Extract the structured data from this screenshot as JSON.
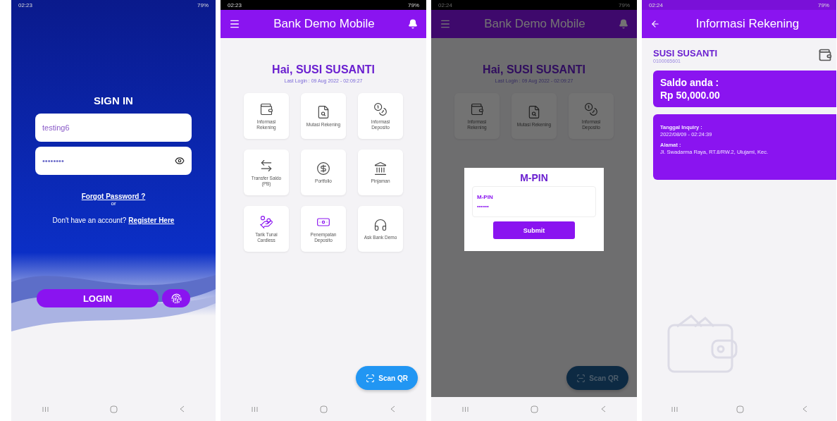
{
  "screens": [
    {
      "kind": "login",
      "status_time": "02:23",
      "battery": "79%",
      "title": "SIGN IN",
      "username": "testing6",
      "password": "••••••••",
      "forgot": "Forgot Password ?",
      "or": "or",
      "register_prompt": "Don't have an account?",
      "register_link": "Register Here",
      "login_button": "LOGIN"
    },
    {
      "kind": "dashboard",
      "status_time": "02:23",
      "battery": "79%",
      "app_title": "Bank Demo Mobile",
      "greeting": "Hai, SUSI SUSANTI",
      "last_login": "Last Login : 09 Aug 2022 - 02:09:27",
      "menu": [
        {
          "label": "Informasi Rekening"
        },
        {
          "label": "Mutasi Rekening"
        },
        {
          "label": "Informasi Deposito"
        },
        {
          "label": "Transfer Saldo (PB)"
        },
        {
          "label": "Portfolio"
        },
        {
          "label": "Pinjaman"
        },
        {
          "label": "Tarik Tunai Cardless"
        },
        {
          "label": "Penempatan Deposito"
        },
        {
          "label": "Ask Bank Demo"
        }
      ],
      "scan_button": "Scan QR"
    },
    {
      "kind": "dashboard_mpin",
      "status_time": "02:24",
      "battery": "79%",
      "app_title": "Bank Demo Mobile",
      "greeting": "Hai, SUSI SUSANTI",
      "last_login": "Last Login : 09 Aug 2022 - 02:09:27",
      "menu": [
        {
          "label": "Informasi Rekening"
        },
        {
          "label": "Mutasi Rekening"
        },
        {
          "label": "Informasi Deposito"
        }
      ],
      "scan_button": "Scan QR",
      "dialog": {
        "title": "M-PIN",
        "field_label": "M-PIN",
        "value": "••••••",
        "submit": "Submit"
      }
    },
    {
      "kind": "account_info",
      "status_time": "02:24",
      "battery": "79%",
      "app_title": "Informasi Rekening",
      "name": "SUSI SUSANTI",
      "account_number": "0100065601",
      "balance_label": "Saldo anda :",
      "balance": "Rp 50,000.00",
      "inquiry_label": "Tanggal Inquiry :",
      "inquiry_date": "2022/08/09 - 02:24:39",
      "address_label": "Alamat :",
      "address": "Jl. Swadarma Raya, RT.8/RW.2, Ulujami, Kec."
    }
  ]
}
